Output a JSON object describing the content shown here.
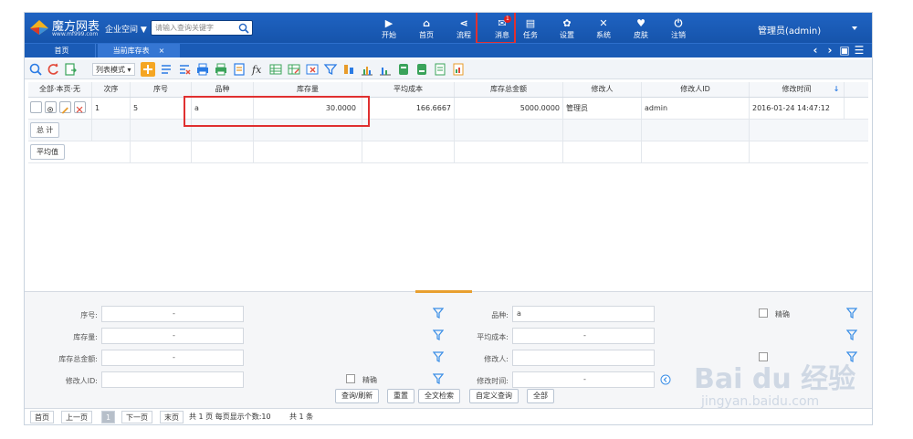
{
  "brand": {
    "name": "魔方网表",
    "url": "www.mf999.com"
  },
  "header": {
    "workspace_label": "企业空间 ▼",
    "search_placeholder": "请输入查询关键字",
    "nav": [
      {
        "icon": "play-icon",
        "glyph": "▶",
        "label": "开始"
      },
      {
        "icon": "home-icon",
        "glyph": "⌂",
        "label": "首页"
      },
      {
        "icon": "flow-icon",
        "glyph": "⋖",
        "label": "流程"
      },
      {
        "icon": "message-icon",
        "glyph": "✉",
        "label": "消息",
        "badge": "1"
      },
      {
        "icon": "task-icon",
        "glyph": "▤",
        "label": "任务"
      },
      {
        "icon": "settings-icon",
        "glyph": "✿",
        "label": "设置"
      },
      {
        "icon": "system-icon",
        "glyph": "✕",
        "label": "系统"
      },
      {
        "icon": "skin-icon",
        "glyph": "♥",
        "label": "皮肤"
      },
      {
        "icon": "logout-icon",
        "glyph": "⏻",
        "label": "注销"
      }
    ],
    "user": "管理员(admin)"
  },
  "tabs": [
    {
      "label": "首页"
    },
    {
      "label": "当前库存表",
      "close": "×"
    }
  ],
  "tab_controls": {
    "prev": "‹",
    "next": "›",
    "save": "▣",
    "menu": "☰"
  },
  "toolbar": {
    "list_mode": "列表模式 ▾"
  },
  "table": {
    "columns": [
      "全部·本页·无",
      "次序",
      "序号",
      "品种",
      "库存量",
      "平均成本",
      "库存总金额",
      "修改人",
      "修改人ID",
      "修改时间"
    ],
    "rows": [
      {
        "order": "1",
        "seq": "5",
        "variety": "a",
        "qty": "30.0000",
        "avg_cost": "166.6667",
        "total": "5000.0000",
        "modifier": "管理员",
        "modifier_id": "admin",
        "modified": "2016-01-24 14:47:12"
      }
    ],
    "total_btn": "总 计",
    "avg_btn": "平均值"
  },
  "filters": {
    "seq_label": "序号:",
    "qty_label": "库存量:",
    "total_label": "库存总金额:",
    "mod_id_label": "修改人ID:",
    "variety_label": "品种:",
    "variety_value": "a",
    "avg_cost_label": "平均成本:",
    "modifier_label": "修改人:",
    "mod_time_label": "修改时间:",
    "dash": "-",
    "exact": "精确",
    "buttons": [
      "查询/刷新",
      "重置",
      "全文检索",
      "自定义查询",
      "全部"
    ]
  },
  "pager": {
    "first": "首页",
    "prev": "上一页",
    "page": "1",
    "next": "下一页",
    "last": "末页",
    "info": "共 1 页 每页显示个数:10",
    "count": "共 1 条"
  },
  "watermark": {
    "brand": "Bai du 经验",
    "url": "jingyan.baidu.com"
  },
  "colors": {
    "header_bg": "#1654ab",
    "accent": "#e03030",
    "filter_icon": "#3a8ee6"
  }
}
